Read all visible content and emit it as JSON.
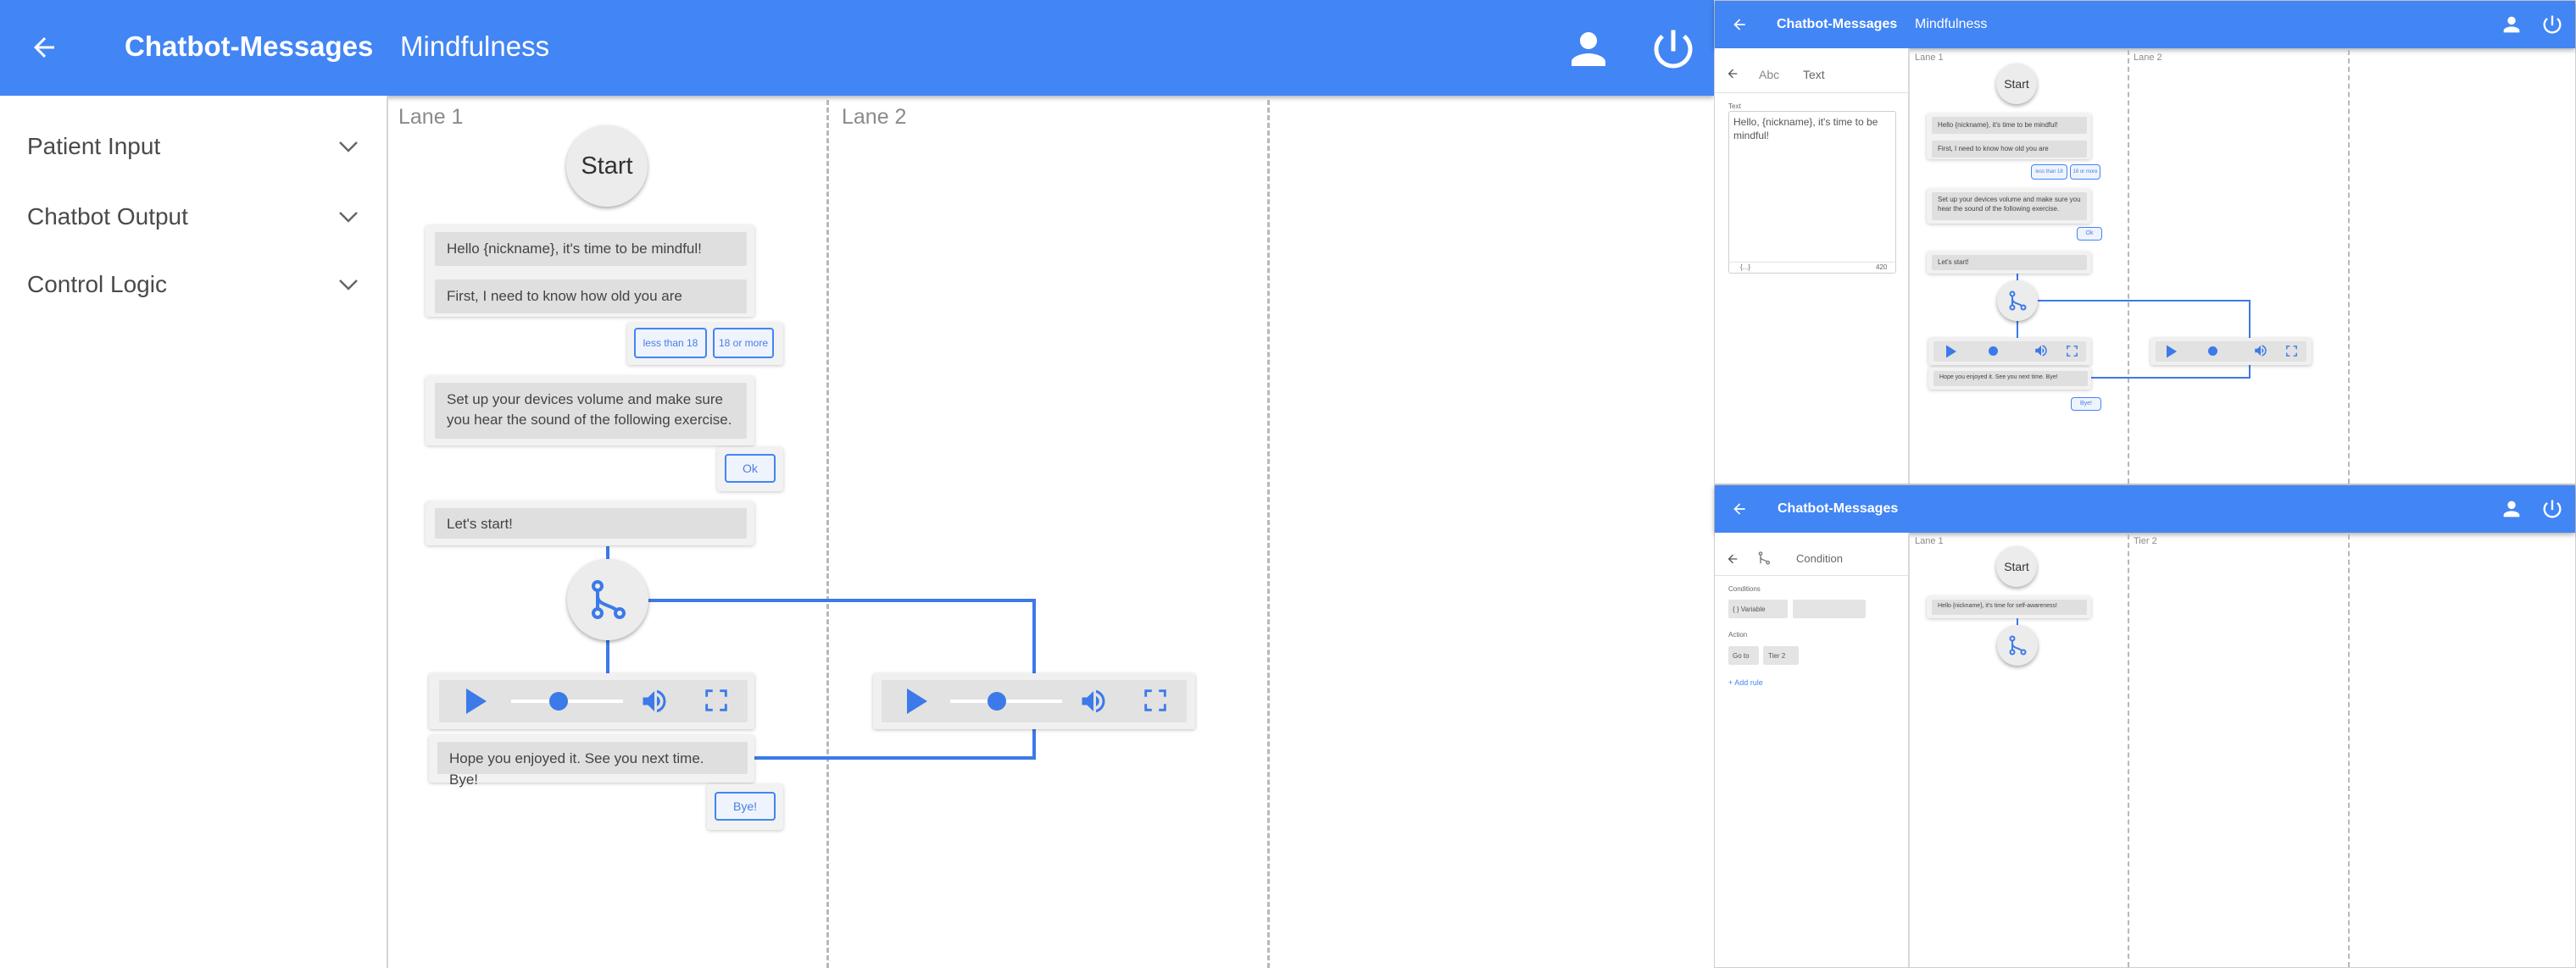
{
  "main": {
    "header": {
      "back_icon": "arrow-left-icon",
      "title": "Chatbot-Messages",
      "subtitle": "Mindfulness",
      "user_icon": "account-icon",
      "power_icon": "power-icon",
      "color": "#4285f4"
    },
    "sidebar": {
      "items": [
        {
          "label": "Patient Input"
        },
        {
          "label": "Chatbot Output"
        },
        {
          "label": "Control Logic"
        }
      ]
    },
    "lanes": [
      {
        "label": "Lane 1"
      },
      {
        "label": "Lane 2"
      }
    ],
    "flow": {
      "start": "Start",
      "msg1": "Hello {nickname}, it's time to be mindful!",
      "msg2": "First, I need to know how old you are",
      "choice1": "less than 18",
      "choice2": "18 or more",
      "msg3": "Set up your devices volume and make sure you hear the sound of the following exercise.",
      "ok": "Ok",
      "msg4": "Let's start!",
      "msg5": "Hope you enjoyed it. See you next time. Bye!",
      "bye": "Bye!",
      "audio_progress": 0.41
    }
  },
  "top_right": {
    "header": {
      "title": "Chatbot-Messages",
      "subtitle": "Mindfulness"
    },
    "editor": {
      "tab_abc": "Abc",
      "tab_text": "Text",
      "field_label": "Text",
      "field_value": "Hello, {nickname}, it's time to be mindful!",
      "insert_label": "{...}",
      "counter": "420"
    },
    "lanes": [
      {
        "label": "Lane 1"
      },
      {
        "label": "Lane 2"
      }
    ],
    "flow": {
      "start": "Start",
      "msg1": "Hello {nickname}, it's time to be mindful!",
      "msg2": "First, I need to know how old you are",
      "choice1": "less than 18",
      "choice2": "18 or more",
      "msg3": "Set up your devices volume and make sure you hear the sound of the following exercise.",
      "ok": "Ok",
      "msg4": "Let's start!",
      "msg5": "Hope you enjoyed it. See you next time. Bye!",
      "bye": "Bye!"
    }
  },
  "bottom_right": {
    "header": {
      "title": "Chatbot-Messages"
    },
    "editor": {
      "title": "Condition",
      "conditions_label": "Conditions",
      "variable_chip": "{ } Variable",
      "action_label": "Action",
      "goto_chip": "Go to",
      "tier_chip": "Tier 2",
      "add_rule": "+ Add rule"
    },
    "lanes": [
      {
        "label": "Lane 1"
      },
      {
        "label": "Tier 2"
      }
    ],
    "flow": {
      "start": "Start",
      "msg1": "Hello {nickname}, it's time for self-awareness!"
    }
  }
}
